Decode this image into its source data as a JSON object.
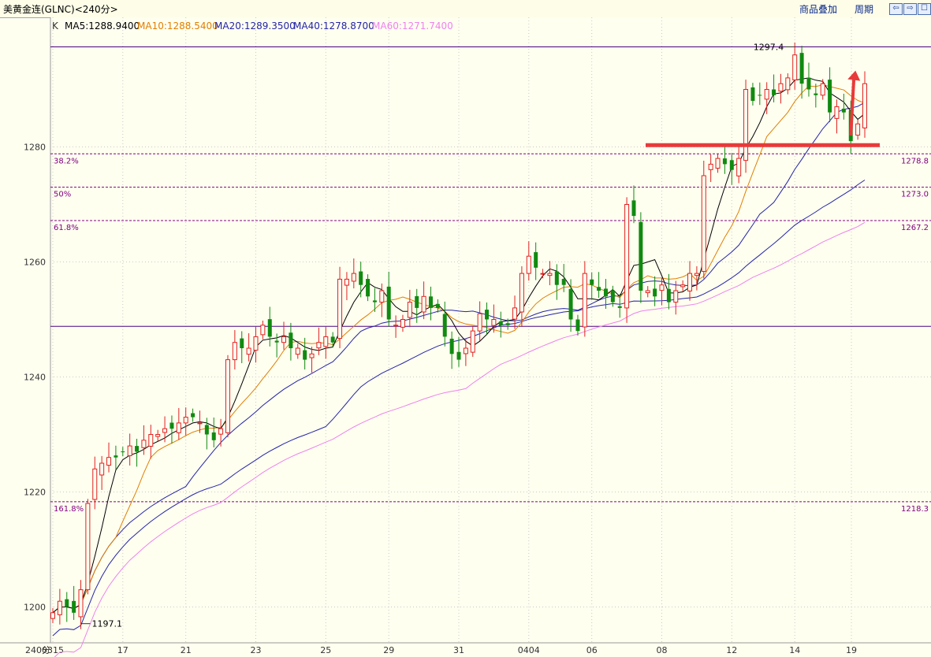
{
  "window": {
    "title": "美黄金连(GLNC)<240分>",
    "buttons": [
      "商品叠加",
      "周期"
    ],
    "nav_icons": [
      "arrow-left-icon",
      "arrow-right-icon",
      "close-icon"
    ]
  },
  "indicators": {
    "prefix": "K",
    "ma5": "MA5:1288.9400",
    "ma10": "MA10:1288.5400",
    "ma20": "MA20:1289.3500",
    "ma40": "MA40:1278.8700",
    "ma60": "MA60:1271.7400",
    "colors": {
      "ma5": "#000000",
      "ma10": "#e07f00",
      "ma20": "#2424a8",
      "ma40": "#2424a8",
      "ma60": "#ee82ee"
    }
  },
  "colors": {
    "up": "#e02020",
    "down": "#108a10",
    "annotation": "#e83a3a",
    "fib": "#800080",
    "background": "#fffff0"
  },
  "chart_data": {
    "type": "candlestick",
    "period_label": "240分",
    "x_labels": [
      "0315",
      "17",
      "21",
      "23",
      "25",
      "29",
      "31",
      "0404",
      "06",
      "08",
      "12",
      "14",
      "19"
    ],
    "y_ticks": [
      1200,
      1220,
      1240,
      1260,
      1280
    ],
    "ylim": [
      1193,
      1300
    ],
    "annotations": {
      "high_label": "1297.4",
      "low_label": "1197.1"
    },
    "fib_levels": [
      {
        "label": "38.2%",
        "value": 1278.8
      },
      {
        "label": "50%",
        "value": 1273.0
      },
      {
        "label": "61.8%",
        "value": 1267.2
      },
      {
        "label": "161.8%",
        "value": 1218.3
      }
    ],
    "fib_value_labels": [
      "1278.8",
      "1273.0",
      "1267.2",
      "1218.3"
    ],
    "reference_lines": [
      1297.4,
      1248.8
    ],
    "support_level": 1280.3,
    "price_path": [
      1199,
      1201,
      1200,
      1199,
      1203,
      1218,
      1224,
      1225,
      1226,
      1226,
      1227,
      1228,
      1227,
      1229,
      1230,
      1230,
      1231,
      1231,
      1232,
      1233,
      1233,
      1232,
      1230,
      1229,
      1231,
      1243,
      1246,
      1245,
      1245,
      1247,
      1249,
      1247,
      1246,
      1247,
      1245,
      1245,
      1243,
      1244,
      1246,
      1247,
      1246,
      1257,
      1257,
      1258,
      1256,
      1254,
      1253,
      1255,
      1250,
      1249,
      1250,
      1253,
      1252,
      1254,
      1252,
      1252,
      1247,
      1244,
      1243,
      1245,
      1248,
      1251,
      1250,
      1250,
      1249,
      1249,
      1252,
      1258,
      1261,
      1259,
      1258,
      1258,
      1256,
      1256,
      1250,
      1248,
      1258,
      1256,
      1255,
      1254,
      1253,
      1252,
      1270,
      1268,
      1255,
      1255,
      1254,
      1256,
      1253,
      1255,
      1256,
      1258,
      1258,
      1275,
      1277,
      1278,
      1277,
      1276,
      1278,
      1290,
      1288,
      1289,
      1290,
      1289,
      1291,
      1292,
      1296,
      1291,
      1290,
      1289,
      1291,
      1286,
      1287,
      1286,
      1281,
      1284,
      1291
    ]
  }
}
